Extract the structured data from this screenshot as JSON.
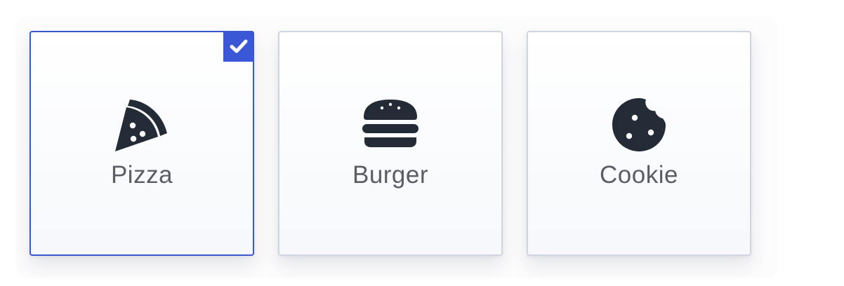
{
  "accent_color": "#3a57d6",
  "icon_color": "#222b36",
  "options": [
    {
      "label": "Pizza",
      "icon": "pizza-slice-icon",
      "selected": true
    },
    {
      "label": "Burger",
      "icon": "hamburger-icon",
      "selected": false
    },
    {
      "label": "Cookie",
      "icon": "cookie-bite-icon",
      "selected": false
    }
  ],
  "selected_indicator_icon": "checkmark-icon"
}
